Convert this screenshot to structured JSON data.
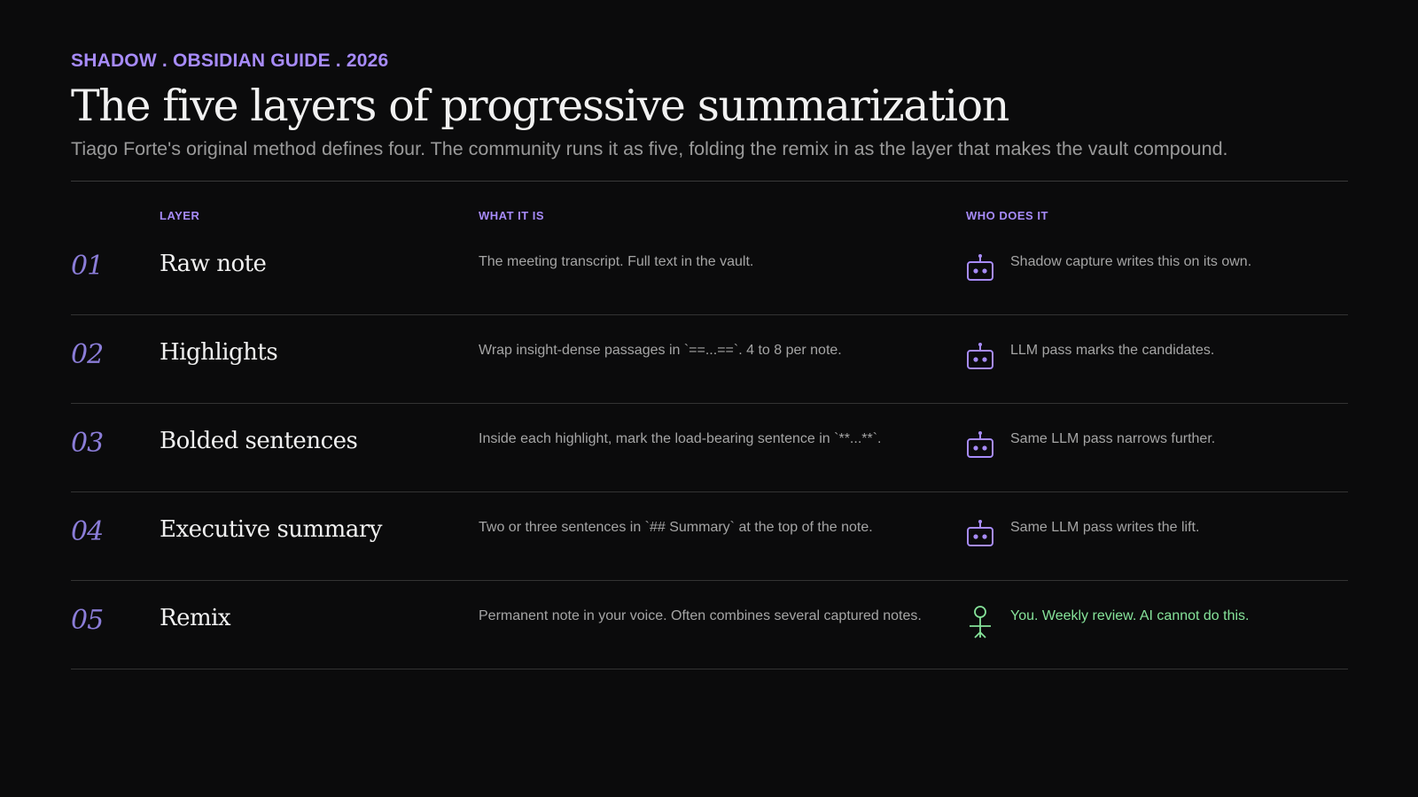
{
  "header": {
    "kicker": "SHADOW . OBSIDIAN GUIDE . 2026",
    "title": "The five layers of progressive summarization",
    "subtitle": "Tiago Forte's original method defines four. The community runs it as five, folding the remix in as the layer that makes the vault compound."
  },
  "columns": {
    "layer": "LAYER",
    "what": "WHAT IT IS",
    "who": "WHO DOES IT"
  },
  "colors": {
    "accent": "#a78bfa",
    "number": "#8b7dd8",
    "human": "#86e39a",
    "background": "#0b0b0c"
  },
  "rows": [
    {
      "number": "01",
      "name": "Raw note",
      "what": "The meeting transcript. Full text in the vault.",
      "who_icon": "robot-icon",
      "who": "Shadow capture writes this on its own."
    },
    {
      "number": "02",
      "name": "Highlights",
      "what": "Wrap insight-dense passages in `==...==`. 4 to 8 per note.",
      "who_icon": "robot-icon",
      "who": "LLM pass marks the candidates."
    },
    {
      "number": "03",
      "name": "Bolded sentences",
      "what": "Inside each highlight, mark the load-bearing sentence in `**...**`.",
      "who_icon": "robot-icon",
      "who": "Same LLM pass narrows further."
    },
    {
      "number": "04",
      "name": "Executive summary",
      "what": "Two or three sentences in `## Summary` at the top of the note.",
      "who_icon": "robot-icon",
      "who": "Same LLM pass writes the lift."
    },
    {
      "number": "05",
      "name": "Remix",
      "what": "Permanent note in your voice. Often combines several captured notes.",
      "who_icon": "person-icon",
      "who": "You. Weekly review. AI cannot do this."
    }
  ]
}
